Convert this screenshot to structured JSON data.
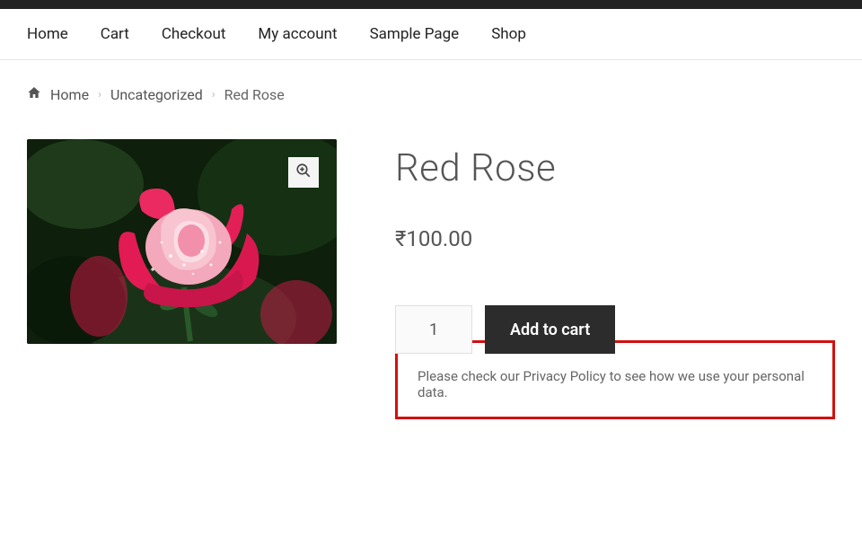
{
  "nav": {
    "items": [
      {
        "label": "Home"
      },
      {
        "label": "Cart"
      },
      {
        "label": "Checkout"
      },
      {
        "label": "My account"
      },
      {
        "label": "Sample Page"
      },
      {
        "label": "Shop"
      }
    ]
  },
  "breadcrumb": {
    "home": "Home",
    "category": "Uncategorized",
    "current": "Red Rose"
  },
  "product": {
    "title": "Red Rose",
    "price": "₹100.00",
    "quantity": "1",
    "add_to_cart_label": "Add to cart"
  },
  "notice": {
    "text": "Please check our Privacy Policy to see how we use your personal data."
  }
}
